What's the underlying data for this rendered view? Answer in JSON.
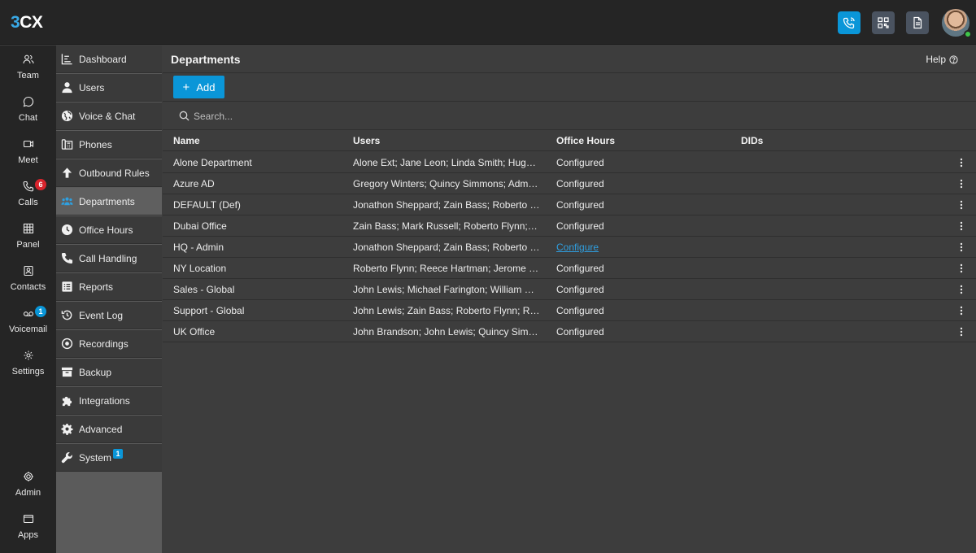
{
  "brand": {
    "logo_prefix": "3",
    "logo_suffix": "CX",
    "accent": "#0a96d8"
  },
  "topbar": {
    "buttons": [
      "phone-icon",
      "qr-code-icon",
      "document-icon"
    ]
  },
  "rail": {
    "items": [
      {
        "label": "Team",
        "icon": "team-icon"
      },
      {
        "label": "Chat",
        "icon": "chat-icon"
      },
      {
        "label": "Meet",
        "icon": "video-icon"
      },
      {
        "label": "Calls",
        "icon": "phone-icon",
        "badge": "6"
      },
      {
        "label": "Panel",
        "icon": "grid-icon"
      },
      {
        "label": "Contacts",
        "icon": "contacts-icon"
      },
      {
        "label": "Voicemail",
        "icon": "voicemail-icon",
        "badge": "1"
      },
      {
        "label": "Settings",
        "icon": "gear-icon"
      }
    ],
    "bottom": [
      {
        "label": "Admin",
        "icon": "admin-gear-icon"
      },
      {
        "label": "Apps",
        "icon": "apps-icon"
      }
    ]
  },
  "sidebar": {
    "items": [
      {
        "label": "Dashboard"
      },
      {
        "label": "Users"
      },
      {
        "label": "Voice & Chat"
      },
      {
        "label": "Phones"
      },
      {
        "label": "Outbound Rules"
      },
      {
        "label": "Departments"
      },
      {
        "label": "Office Hours"
      },
      {
        "label": "Call Handling"
      },
      {
        "label": "Reports"
      },
      {
        "label": "Event Log"
      },
      {
        "label": "Recordings"
      },
      {
        "label": "Backup"
      },
      {
        "label": "Integrations"
      },
      {
        "label": "Advanced"
      },
      {
        "label": "System",
        "badge": "1"
      }
    ]
  },
  "main": {
    "title": "Departments",
    "help_label": "Help",
    "add_label": "Add",
    "search_placeholder": "Search...",
    "columns": {
      "name": "Name",
      "users": "Users",
      "hours": "Office Hours",
      "dids": "DIDs"
    },
    "rows": [
      {
        "name": "Alone Department",
        "users": "Alone Ext; Jane Leon; Linda Smith; Hugo S...",
        "hours": "Configured",
        "dids": ""
      },
      {
        "name": "Azure AD",
        "users": "Gregory Winters; Quincy Simmons; Admin ...",
        "hours": "Configured",
        "dids": ""
      },
      {
        "name": "DEFAULT (Def)",
        "users": "Jonathon Sheppard; Zain Bass; Roberto Fl...",
        "hours": "Configured",
        "dids": ""
      },
      {
        "name": "Dubai Office",
        "users": "Zain Bass; Mark Russell; Roberto Flynn; R...",
        "hours": "Configured",
        "dids": ""
      },
      {
        "name": "HQ - Admin",
        "users": "Jonathon Sheppard; Zain Bass; Roberto Fl...",
        "hours": "Configure",
        "dids": ""
      },
      {
        "name": "NY Location",
        "users": "Roberto Flynn; Reece Hartman; Jerome Fr...",
        "hours": "Configured",
        "dids": ""
      },
      {
        "name": "Sales - Global",
        "users": "John Lewis; Michael Farington; William Har...",
        "hours": "Configured",
        "dids": ""
      },
      {
        "name": "Support - Global",
        "users": "John Lewis; Zain Bass; Roberto Flynn; Ree...",
        "hours": "Configured",
        "dids": ""
      },
      {
        "name": "UK Office",
        "users": "John Brandson; John Lewis; Quincy Simm...",
        "hours": "Configured",
        "dids": ""
      }
    ]
  }
}
